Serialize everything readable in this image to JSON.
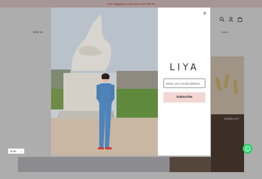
{
  "announcement": "Free shipping on all orders over 500 lei",
  "nav": {
    "left_item": "NEW IN",
    "sale": "SALE"
  },
  "icons": {
    "search": "search-icon",
    "account": "user-icon",
    "cart": "bag-icon"
  },
  "background": {
    "jewelry_label": "JEWELRY"
  },
  "popup": {
    "brand": "LIYA",
    "email_placeholder": "Enter your email address",
    "subscribe_label": "Subscribe",
    "close_label": "×"
  },
  "footer": {
    "currency_label": "$ UK",
    "currency_chevron": "⌄"
  },
  "colors": {
    "accent": "#f3d6d3",
    "sale_red": "#c0392b",
    "whatsapp_green": "#25d366"
  }
}
